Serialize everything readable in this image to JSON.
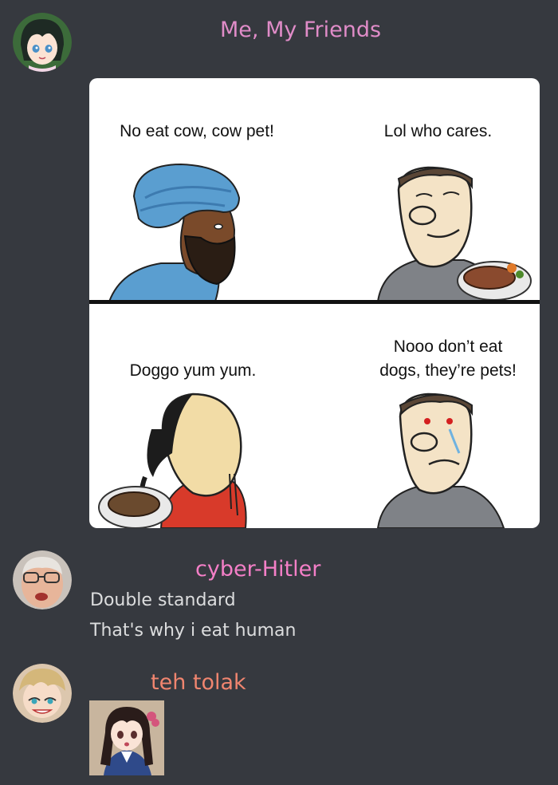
{
  "messages": [
    {
      "author": "Me, My Friends",
      "author_color": "#e08cc8",
      "meme": {
        "panel1_caption": "No eat cow, cow pet!",
        "panel2_caption": "Lol who cares.",
        "panel3_caption": "Doggo yum yum.",
        "panel4_caption_line1": "Nooo don’t eat",
        "panel4_caption_line2": "dogs, they’re pets!"
      }
    },
    {
      "author": "cyber-Hitler",
      "author_color": "#f47fc7",
      "lines": [
        "Double standard",
        "That's why i eat human"
      ]
    },
    {
      "author": "teh tolak",
      "author_color": "#f0856f"
    }
  ]
}
